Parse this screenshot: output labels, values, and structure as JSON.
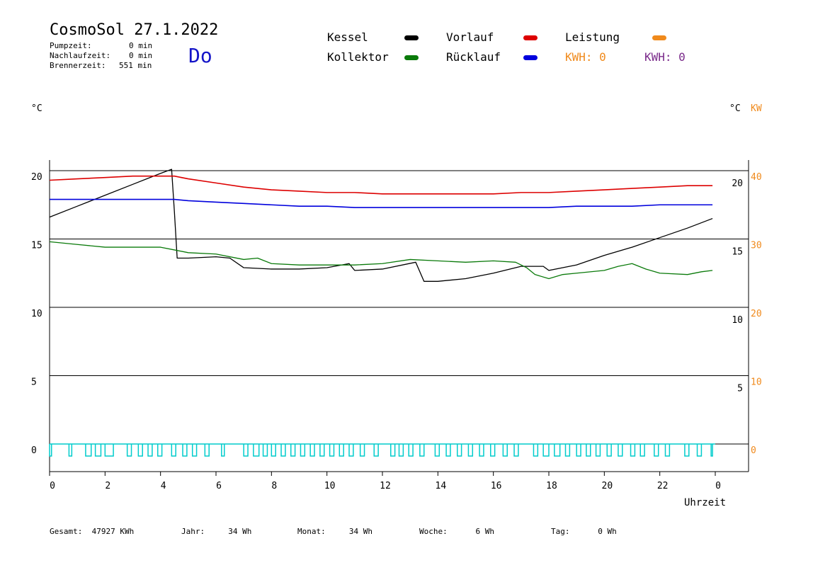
{
  "header": {
    "title": "CosmoSol 27.1.2022",
    "day": "Do",
    "pump_label": "Pumpzeit:",
    "pump_value": "0 min",
    "nachlauf_label": "Nachlaufzeit:",
    "nachlauf_value": "0 min",
    "brenner_label": "Brennerzeit:",
    "brenner_value": "551 min"
  },
  "legend": {
    "kessel": "Kessel",
    "kollektor": "Kollektor",
    "vorlauf": "Vorlauf",
    "ruecklauf": "Rücklauf",
    "leistung": "Leistung",
    "kwh1": "KWH: 0",
    "kwh2": "KWH: 0"
  },
  "units": {
    "left": "°C",
    "right_c": "°C",
    "right_kw": "KW",
    "xlabel": "Uhrzeit"
  },
  "colors": {
    "kessel": "#000000",
    "kollektor": "#0a7a0a",
    "vorlauf": "#dd0000",
    "ruecklauf": "#0000dd",
    "leistung": "#f08a1c",
    "kwh2": "#7a2a8a",
    "pump": "#00cccc"
  },
  "footer": {
    "gesamt": "Gesamt:  47927 KWh",
    "jahr": "Jahr:     34 Wh",
    "monat": "Monat:     34 Wh",
    "woche": "Woche:      6 Wh",
    "tag": "Tag:      0 Wh"
  },
  "chart_data": {
    "type": "line",
    "x_unit": "hour",
    "xlim": [
      0,
      24
    ],
    "ylim": [
      0,
      20
    ],
    "y_right_kw_lim": [
      0,
      40
    ],
    "x_ticks": [
      "0",
      "2",
      "4",
      "6",
      "8",
      "10",
      "12",
      "14",
      "16",
      "18",
      "20",
      "22",
      "0"
    ],
    "y_ticks_left": [
      "0",
      "5",
      "10",
      "15",
      "20"
    ],
    "y_ticks_right_c": [
      "5",
      "10",
      "15",
      "20"
    ],
    "y_ticks_right_kw": [
      "0",
      "10",
      "20",
      "30",
      "40"
    ],
    "series": [
      {
        "name": "Kessel",
        "color_key": "kessel",
        "x": [
          0,
          1,
          2,
          3,
          4,
          4.4,
          4.5,
          4.6,
          5,
          6,
          6.5,
          7,
          8,
          9,
          10,
          10.8,
          11,
          12,
          13.2,
          13.5,
          14,
          15,
          16,
          17,
          17.8,
          18,
          19,
          20,
          21,
          22,
          23,
          23.9
        ],
        "y": [
          16.6,
          17.4,
          18.2,
          19,
          19.8,
          20.1,
          17,
          13.6,
          13.6,
          13.7,
          13.6,
          12.9,
          12.8,
          12.8,
          12.9,
          13.2,
          12.7,
          12.8,
          13.3,
          11.9,
          11.9,
          12.1,
          12.5,
          13,
          13,
          12.7,
          13.1,
          13.8,
          14.4,
          15.1,
          15.8,
          16.5
        ]
      },
      {
        "name": "Kollektor",
        "color_key": "kollektor",
        "x": [
          0,
          1,
          2,
          3,
          4,
          4.5,
          5,
          6,
          7,
          7.5,
          8,
          9,
          10,
          11,
          12,
          13,
          14,
          15,
          16,
          16.8,
          17.2,
          17.5,
          18,
          18.5,
          19,
          20,
          20.5,
          21,
          21.5,
          22,
          23,
          23.5,
          23.9
        ],
        "y": [
          14.8,
          14.6,
          14.4,
          14.4,
          14.4,
          14.2,
          14.0,
          13.9,
          13.5,
          13.6,
          13.2,
          13.1,
          13.1,
          13.1,
          13.2,
          13.5,
          13.4,
          13.3,
          13.4,
          13.3,
          12.9,
          12.4,
          12.1,
          12.4,
          12.5,
          12.7,
          13.0,
          13.2,
          12.8,
          12.5,
          12.4,
          12.6,
          12.7
        ]
      },
      {
        "name": "Vorlauf",
        "color_key": "vorlauf",
        "x": [
          0,
          1,
          2,
          3,
          4,
          4.5,
          5,
          6,
          7,
          8,
          9,
          10,
          11,
          12,
          13,
          14,
          15,
          16,
          17,
          18,
          19,
          20,
          21,
          22,
          23,
          23.9
        ],
        "y": [
          19.3,
          19.4,
          19.5,
          19.6,
          19.6,
          19.6,
          19.4,
          19.1,
          18.8,
          18.6,
          18.5,
          18.4,
          18.4,
          18.3,
          18.3,
          18.3,
          18.3,
          18.3,
          18.4,
          18.4,
          18.5,
          18.6,
          18.7,
          18.8,
          18.9,
          18.9
        ]
      },
      {
        "name": "Rücklauf",
        "color_key": "ruecklauf",
        "x": [
          0,
          2,
          4,
          4.5,
          5,
          6,
          7,
          8,
          9,
          10,
          11,
          12,
          13,
          14,
          15,
          16,
          17,
          18,
          19,
          20,
          21,
          22,
          23,
          23.9
        ],
        "y": [
          17.9,
          17.9,
          17.9,
          17.9,
          17.8,
          17.7,
          17.6,
          17.5,
          17.4,
          17.4,
          17.3,
          17.3,
          17.3,
          17.3,
          17.3,
          17.3,
          17.3,
          17.3,
          17.4,
          17.4,
          17.4,
          17.5,
          17.5,
          17.5
        ]
      }
    ]
  }
}
